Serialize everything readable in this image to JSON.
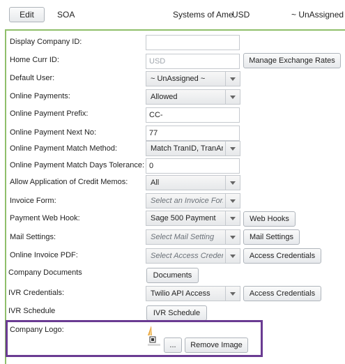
{
  "toolbar": {
    "edit_label": "Edit",
    "company_code": "SOA",
    "company_name": "Systems of Ame",
    "currency": "USD",
    "user": "~ UnAssigned ~"
  },
  "form": {
    "display_company_id": {
      "label": "Display Company ID:",
      "value": ""
    },
    "home_curr_id": {
      "label": "Home Curr ID:",
      "placeholder": "USD",
      "button": "Manage Exchange Rates"
    },
    "default_user": {
      "label": "Default User:",
      "value": "~ UnAssigned ~"
    },
    "online_payments": {
      "label": "Online Payments:",
      "value": "Allowed"
    },
    "online_payment_prefix": {
      "label": "Online Payment Prefix:",
      "value": "CC-"
    },
    "online_payment_next_no": {
      "label": "Online Payment Next No:",
      "value": "77"
    },
    "online_payment_match_method": {
      "label": "Online Payment Match Method:",
      "value": "Match TranID, TranAmt"
    },
    "online_payment_match_days_tolerance": {
      "label": "Online Payment Match Days Tolerance:",
      "value": "0"
    },
    "allow_application_of_credit_memos": {
      "label": "Allow Application of Credit Memos:",
      "value": "All"
    },
    "invoice_form": {
      "label": "Invoice Form:",
      "placeholder": "Select an Invoice Form"
    },
    "payment_web_hook": {
      "label": "Payment Web Hook:",
      "value": "Sage 500 Payment",
      "button": "Web Hooks"
    },
    "mail_settings": {
      "label": "Mail Settings:",
      "placeholder": "Select Mail Setting",
      "button": "Mail Settings"
    },
    "online_invoice_pdf": {
      "label": "Online Invoice PDF:",
      "placeholder": "Select Access Credentials",
      "button": "Access Credentials"
    },
    "company_documents": {
      "label": "Company Documents",
      "button": "Documents"
    },
    "ivr_credentials": {
      "label": "IVR Credentials:",
      "value": "Twilio API Access",
      "button": "Access Credentials"
    },
    "ivr_schedule": {
      "label": "IVR Schedule",
      "button": "IVR Schedule"
    },
    "company_logo": {
      "label": "Company Logo:",
      "browse_button": "...",
      "remove_button": "Remove Image"
    }
  },
  "colors": {
    "panel_border": "#8fbf6a",
    "logo_highlight": "#6a3b92"
  },
  "icons": {
    "logo_image": "broken-image-icon"
  }
}
